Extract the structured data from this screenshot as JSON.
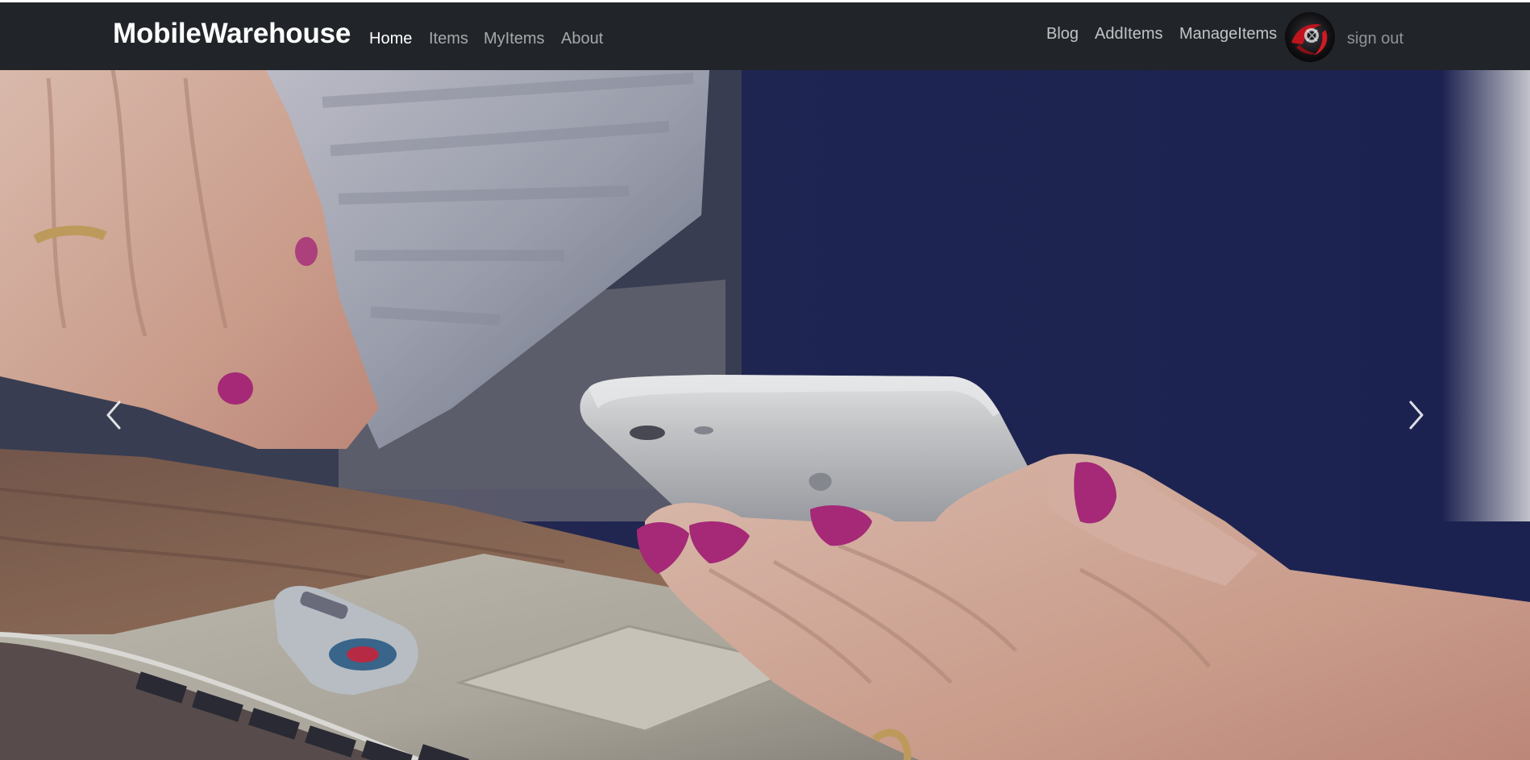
{
  "navbar": {
    "brand": "MobileWarehouse",
    "left_links": [
      {
        "label": "Home",
        "active": true
      },
      {
        "label": "Items"
      },
      {
        "label": "MyItems"
      },
      {
        "label": "About"
      }
    ],
    "right_links": [
      {
        "label": "Blog"
      },
      {
        "label": "AddItems"
      },
      {
        "label": "ManageItems"
      }
    ],
    "avatar_icon": "user-avatar-icon",
    "signout_label": "sign out",
    "background_color": "#212529"
  },
  "carousel": {
    "slide_icon": "woman-holding-smartphone-photo",
    "prev_icon": "chevron-left-icon",
    "next_icon": "chevron-right-icon"
  },
  "colors": {
    "nav_text": "#ffffff",
    "nav_muted": "#9ea2a6",
    "nail_polish": "#b0297a"
  }
}
